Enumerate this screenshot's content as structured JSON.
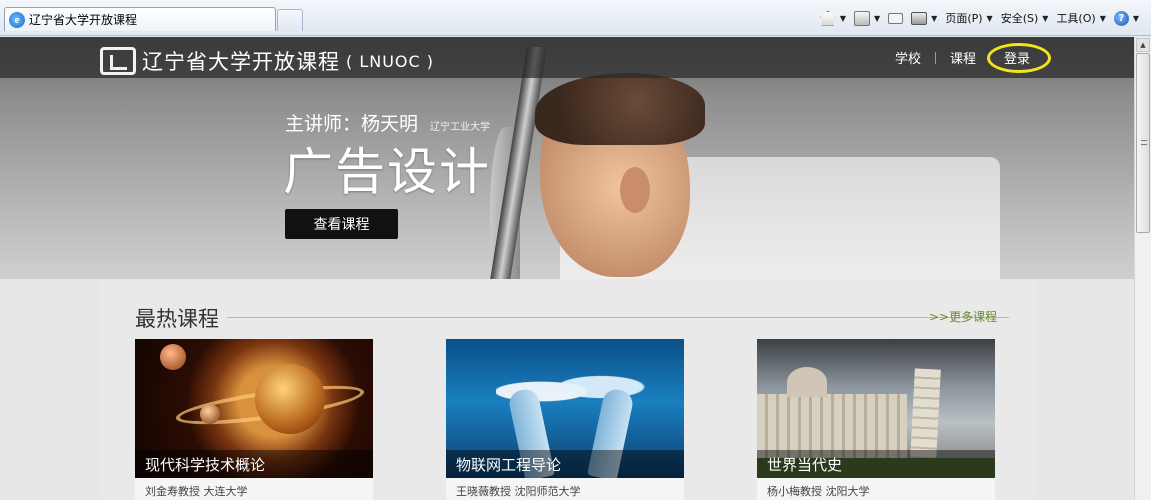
{
  "browser": {
    "tab_title": "辽宁省大学开放课程",
    "commands": {
      "page": "页面(P)",
      "safety": "安全(S)",
      "tools": "工具(O)"
    }
  },
  "header": {
    "logo_text": "辽宁省大学开放课程",
    "logo_sub": "( LNUOC )",
    "nav": {
      "school": "学校",
      "courses": "课程",
      "login": "登录"
    }
  },
  "hero": {
    "lecturer": "主讲师：杨天明",
    "lecturer_school": "辽宁工业大学",
    "course_title": "广告设计",
    "cta_label": "查看课程"
  },
  "hot_courses": {
    "title": "最热课程",
    "more_label": ">>更多课程",
    "items": [
      {
        "title": "现代科学技术概论",
        "meta": "刘金寿教授 大连大学"
      },
      {
        "title": "物联网工程导论",
        "meta": "王晓薇教授 沈阳师范大学"
      },
      {
        "title": "世界当代史",
        "meta": "杨小梅教授 沈阳大学"
      }
    ]
  },
  "colors": {
    "login_highlight": "#f3e31a",
    "more_link": "#6b8a2e"
  }
}
